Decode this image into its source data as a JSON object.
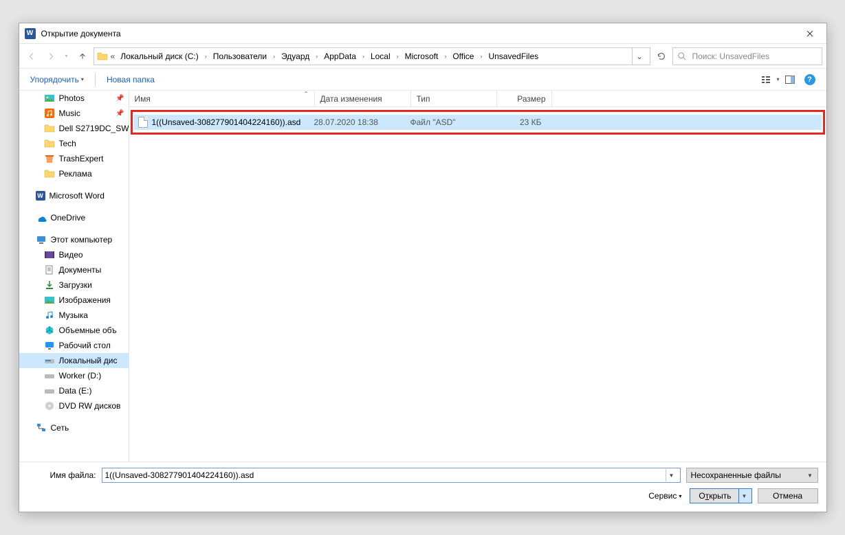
{
  "titlebar": {
    "title": "Открытие документа"
  },
  "path": {
    "prefix": "«",
    "segments": [
      "Локальный диск (C:)",
      "Пользователи",
      "Эдуард",
      "AppData",
      "Local",
      "Microsoft",
      "Office",
      "UnsavedFiles"
    ]
  },
  "search": {
    "placeholder": "Поиск: UnsavedFiles"
  },
  "toolbar": {
    "organize": "Упорядочить",
    "newfolder": "Новая папка"
  },
  "columns": {
    "name": "Имя",
    "date": "Дата изменения",
    "type": "Тип",
    "size": "Размер"
  },
  "sidebar": {
    "photos": "Photos",
    "music": "Music",
    "dell": "Dell S2719DC_SW",
    "tech": "Tech",
    "trash": "TrashExpert",
    "ads": "Реклама",
    "word": "Microsoft Word",
    "onedrive": "OneDrive",
    "thispc": "Этот компьютер",
    "video": "Видео",
    "docs": "Документы",
    "downloads": "Загрузки",
    "pictures": "Изображения",
    "musicru": "Музыка",
    "volumes": "Объемные объ",
    "desktop": "Рабочий стол",
    "localdisk": "Локальный дис",
    "worker": "Worker (D:)",
    "data": "Data (E:)",
    "dvd": "DVD RW дисков",
    "network": "Сеть"
  },
  "file": {
    "name": "1((Unsaved-308277901404224160)).asd",
    "date": "28.07.2020 18:38",
    "type": "Файл \"ASD\"",
    "size": "23 КБ"
  },
  "footer": {
    "filename_label": "Имя файла:",
    "filename_value": "1((Unsaved-308277901404224160)).asd",
    "filter": "Несохраненные файлы",
    "service": "Сервис",
    "open_pre": "О",
    "open_und": "т",
    "open_post": "крыть",
    "cancel": "Отмена"
  }
}
